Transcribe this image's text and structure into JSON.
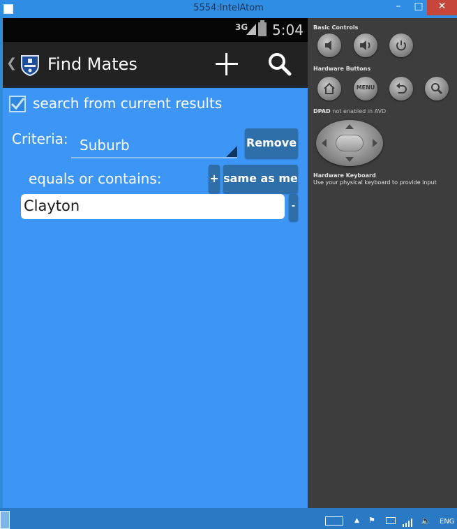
{
  "window": {
    "title": "5554:IntelAtom",
    "minimize": "–",
    "maximize": "□",
    "close": "✕"
  },
  "device": {
    "status": {
      "network": "3G",
      "time": "5:04"
    },
    "actionbar": {
      "title": "Find Mates",
      "icons": [
        "back-chevron-icon",
        "crest-logo-icon",
        "plus-icon",
        "search-icon"
      ]
    },
    "form": {
      "checkbox_label": "search from current results",
      "checkbox_checked": true,
      "criteria_label": "Criteria:",
      "criteria_selected": "Suburb",
      "remove_label": "Remove",
      "equals_label": "equals or contains:",
      "plus_label": "+",
      "same_as_me_label": "same as me",
      "value": "Clayton",
      "minus_label": "-"
    }
  },
  "panel": {
    "basic_controls": "Basic Controls",
    "hardware_buttons": "Hardware Buttons",
    "menu_label": "MENU",
    "dpad_title": "DPAD",
    "dpad_note": "not enabled in AVD",
    "keyboard_title": "Hardware Keyboard",
    "keyboard_note": "Use your physical keyboard to provide input"
  },
  "taskbar": {
    "language": "ENG"
  },
  "colors": {
    "screen": "#3d96f5",
    "panel": "#3d3d3d",
    "button": "#2e6ea9",
    "titlebar": "#2f8de3"
  }
}
